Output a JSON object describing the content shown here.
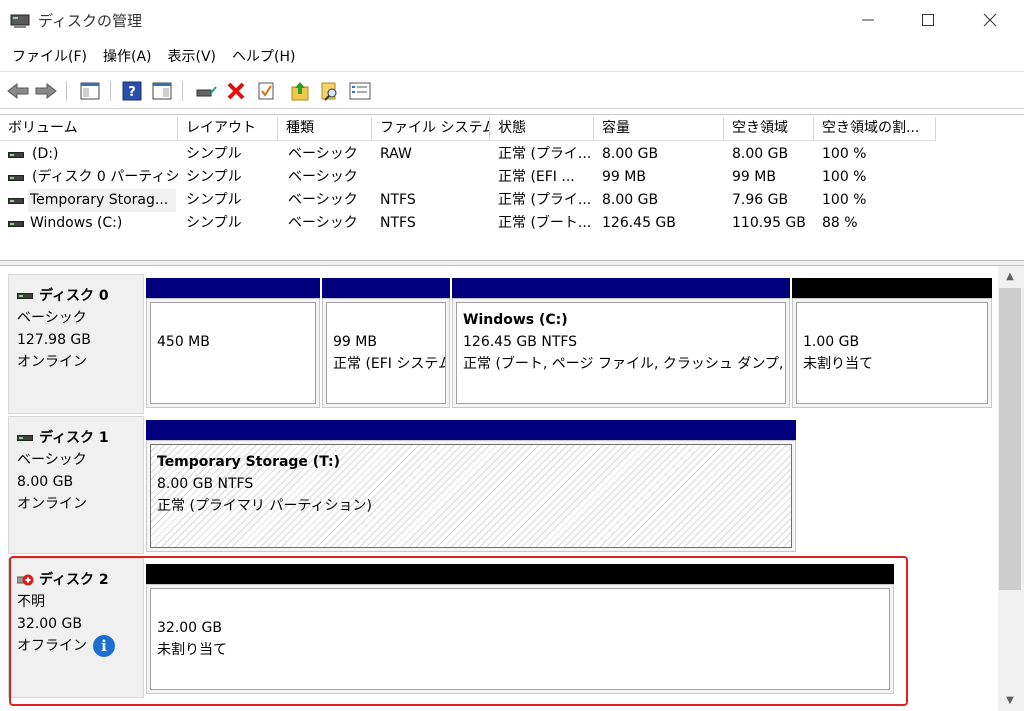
{
  "window": {
    "title": "ディスクの管理"
  },
  "menu": [
    {
      "label": "ファイル(F)"
    },
    {
      "label": "操作(A)"
    },
    {
      "label": "表示(V)"
    },
    {
      "label": "ヘルプ(H)"
    }
  ],
  "volume_list": {
    "columns": [
      "ボリューム",
      "レイアウト",
      "種類",
      "ファイル システム",
      "状態",
      "容量",
      "空き領域",
      "空き領域の割..."
    ],
    "rows": [
      {
        "volume": "(D:)",
        "layout": "シンプル",
        "type": "ベーシック",
        "fs": "RAW",
        "status": "正常 (プライ...",
        "capacity": "8.00 GB",
        "free": "8.00 GB",
        "free_pct": "100 %"
      },
      {
        "volume": "(ディスク 0 パーティショ...",
        "layout": "シンプル",
        "type": "ベーシック",
        "fs": "",
        "status": "正常 (EFI ...",
        "capacity": "99 MB",
        "free": "99 MB",
        "free_pct": "100 %"
      },
      {
        "volume": "Temporary Storag...",
        "layout": "シンプル",
        "type": "ベーシック",
        "fs": "NTFS",
        "status": "正常 (プライ...",
        "capacity": "8.00 GB",
        "free": "7.96 GB",
        "free_pct": "100 %"
      },
      {
        "volume": "Windows (C:)",
        "layout": "シンプル",
        "type": "ベーシック",
        "fs": "NTFS",
        "status": "正常 (ブート...",
        "capacity": "126.45 GB",
        "free": "110.95 GB",
        "free_pct": "88 %"
      }
    ]
  },
  "disks": [
    {
      "name": "ディスク 0",
      "kind": "ベーシック",
      "size": "127.98 GB",
      "state": "オンライン",
      "partitions": [
        {
          "line1": "450 MB",
          "line2": "",
          "line3": ""
        },
        {
          "line1": "99 MB",
          "line2": "正常 (EFI システム",
          "line3": ""
        },
        {
          "title": "Windows  (C:)",
          "line1": "126.45 GB NTFS",
          "line2": "正常 (ブート, ページ ファイル, クラッシュ ダンプ, ベーシッ",
          "line3": ""
        },
        {
          "line1": "1.00 GB",
          "line2": "未割り当て",
          "line3": ""
        }
      ]
    },
    {
      "name": "ディスク 1",
      "kind": "ベーシック",
      "size": "8.00 GB",
      "state": "オンライン",
      "partitions": [
        {
          "title": "Temporary Storage  (T:)",
          "line1": "8.00 GB NTFS",
          "line2": "正常 (プライマリ パーティション)"
        }
      ]
    },
    {
      "name": "ディスク 2",
      "kind": "不明",
      "size": "32.00 GB",
      "state": "オフライン",
      "partitions": [
        {
          "line1": "32.00 GB",
          "line2": "未割り当て"
        }
      ]
    }
  ],
  "colors": {
    "primary_bar": "#00007f",
    "unallocated_bar": "#000000",
    "highlight_border": "#e02020",
    "info_icon": "#1a6fd0"
  },
  "icons": [
    "back-icon",
    "forward-icon",
    "console-tree-icon",
    "help-icon",
    "action-pane-icon",
    "connect-icon",
    "delete-icon",
    "properties-icon",
    "export-icon",
    "rescan-icon",
    "list-icon",
    "info-icon"
  ]
}
